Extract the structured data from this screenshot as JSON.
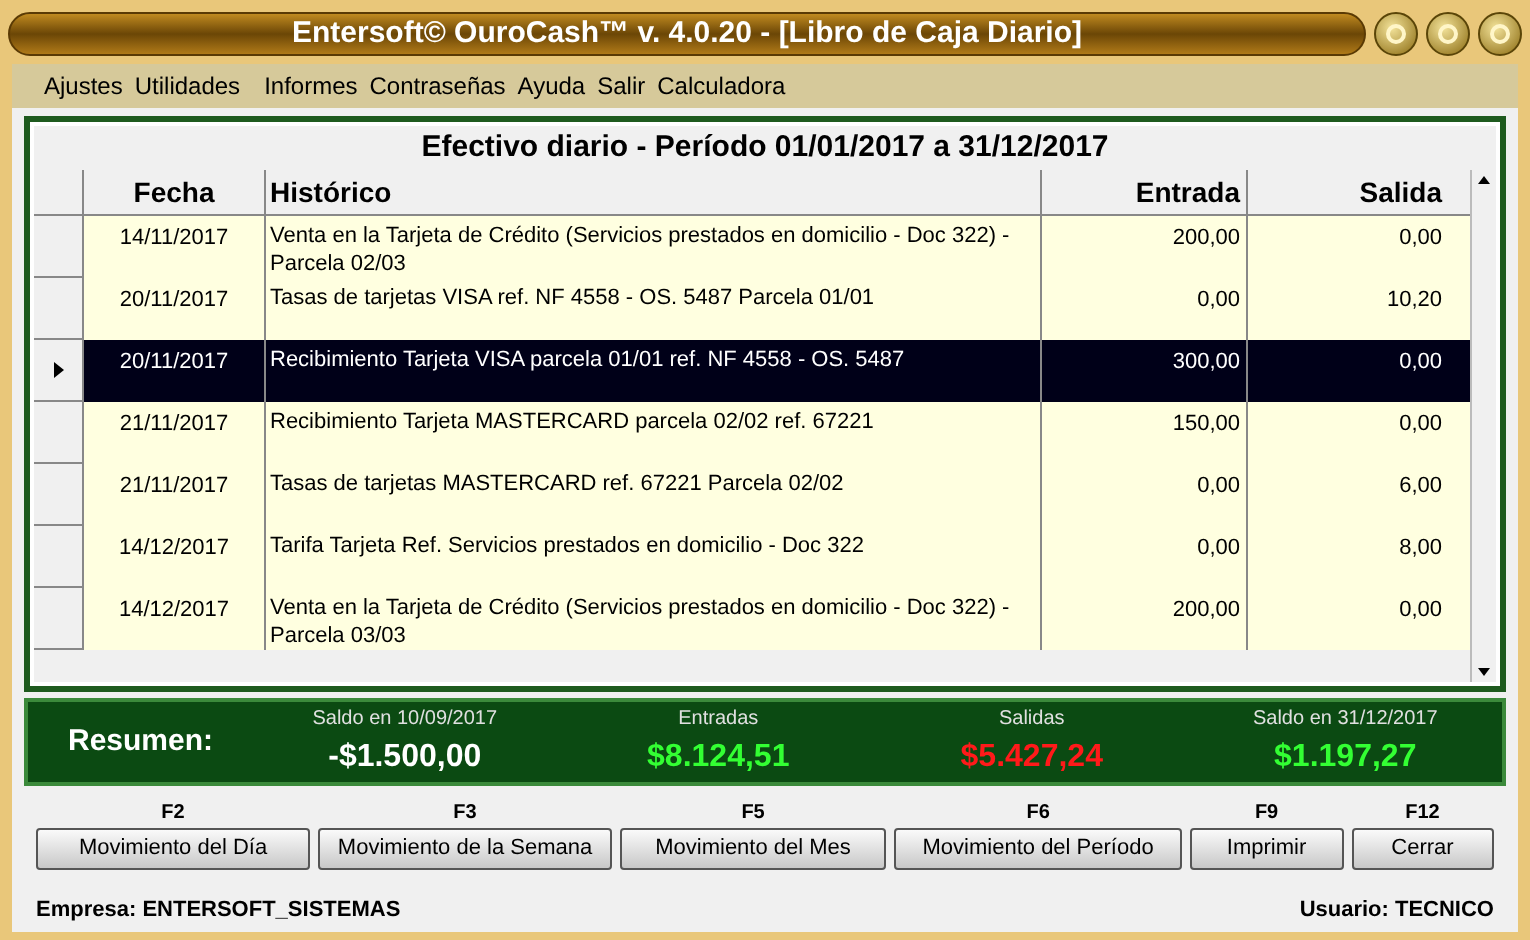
{
  "window": {
    "title": "Entersoft© OuroCash™ v. 4.0.20 - [Libro de Caja Diario]"
  },
  "menu": [
    "Ajustes",
    "Utilidades",
    "Informes",
    "Contraseñas",
    "Ayuda",
    "Salir",
    "Calculadora"
  ],
  "grid": {
    "title": "Efectivo diario - Período 01/01/2017 a 31/12/2017",
    "columns": [
      "Fecha",
      "Histórico",
      "Entrada",
      "Salida"
    ],
    "rows": [
      {
        "date": "14/11/2017",
        "history": "Venta en la Tarjeta de Crédito (Servicios prestados en domicilio - Doc 322) - Parcela 02/03",
        "in": "200,00",
        "out": "0,00",
        "selected": false
      },
      {
        "date": "20/11/2017",
        "history": "Tasas de tarjetas VISA ref. NF 4558 - OS. 5487 Parcela 01/01",
        "in": "0,00",
        "out": "10,20",
        "selected": false
      },
      {
        "date": "20/11/2017",
        "history": "Recibimiento Tarjeta VISA parcela 01/01 ref. NF 4558 - OS. 5487",
        "in": "300,00",
        "out": "0,00",
        "selected": true
      },
      {
        "date": "21/11/2017",
        "history": "Recibimiento Tarjeta MASTERCARD parcela 02/02 ref. 67221",
        "in": "150,00",
        "out": "0,00",
        "selected": false
      },
      {
        "date": "21/11/2017",
        "history": "Tasas de tarjetas MASTERCARD ref. 67221 Parcela 02/02",
        "in": "0,00",
        "out": "6,00",
        "selected": false
      },
      {
        "date": "14/12/2017",
        "history": "Tarifa Tarjeta Ref. Servicios prestados en domicilio - Doc 322",
        "in": "0,00",
        "out": "8,00",
        "selected": false
      },
      {
        "date": "14/12/2017",
        "history": "Venta en la Tarjeta de Crédito (Servicios prestados en domicilio - Doc 322) - Parcela 03/03",
        "in": "200,00",
        "out": "0,00",
        "selected": false
      }
    ]
  },
  "summary": {
    "label": "Resumen:",
    "items": [
      {
        "label": "Saldo en 10/09/2017",
        "value": "-$1.500,00",
        "color": "#ffffff"
      },
      {
        "label": "Entradas",
        "value": "$8.124,51",
        "color": "#33ff33"
      },
      {
        "label": "Salidas",
        "value": "$5.427,24",
        "color": "#ff1a1a"
      },
      {
        "label": "Saldo en 31/12/2017",
        "value": "$1.197,27",
        "color": "#33ff33"
      }
    ]
  },
  "buttons": [
    {
      "key": "F2",
      "label": "Movimiento del Día"
    },
    {
      "key": "F3",
      "label": "Movimiento de la Semana"
    },
    {
      "key": "F5",
      "label": "Movimiento del Mes"
    },
    {
      "key": "F6",
      "label": "Movimiento del Período"
    },
    {
      "key": "F9",
      "label": "Imprimir"
    },
    {
      "key": "F12",
      "label": "Cerrar"
    }
  ],
  "status_bar": {
    "company": "Empresa: ENTERSOFT_SISTEMAS",
    "user": "Usuario: TECNICO"
  }
}
